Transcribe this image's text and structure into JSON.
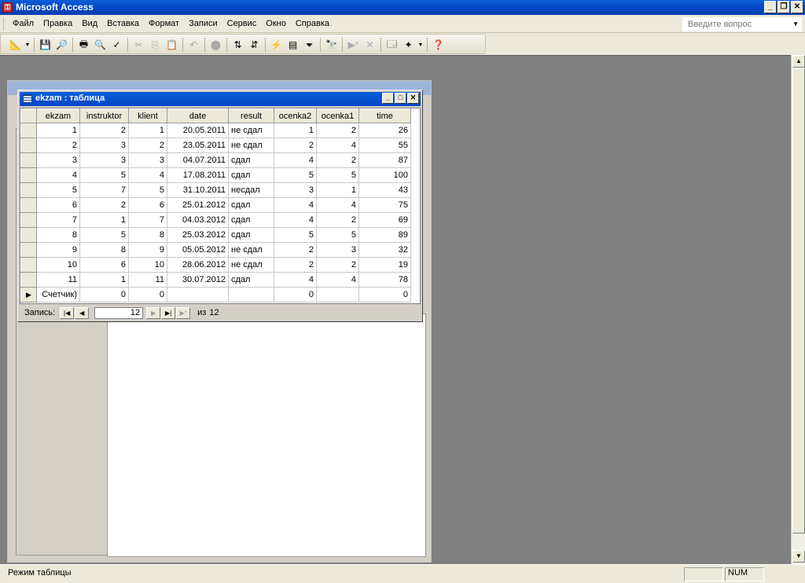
{
  "app": {
    "title": "Microsoft Access"
  },
  "menu": {
    "items": [
      "Файл",
      "Правка",
      "Вид",
      "Вставка",
      "Формат",
      "Записи",
      "Сервис",
      "Окно",
      "Справка"
    ],
    "help_placeholder": "Введите вопрос"
  },
  "table_window": {
    "title": "ekzam : таблица",
    "columns": [
      "ekzam",
      "instruktor",
      "klient",
      "date",
      "result",
      "ocenka2",
      "ocenka1",
      "time"
    ],
    "rows": [
      [
        "1",
        "2",
        "1",
        "20.05.2011",
        "не сдал",
        "1",
        "2",
        "26"
      ],
      [
        "2",
        "3",
        "2",
        "23.05.2011",
        "не сдал",
        "2",
        "4",
        "55"
      ],
      [
        "3",
        "3",
        "3",
        "04.07.2011",
        "сдал",
        "4",
        "2",
        "87"
      ],
      [
        "4",
        "5",
        "4",
        "17.08.2011",
        "сдал",
        "5",
        "5",
        "100"
      ],
      [
        "5",
        "7",
        "5",
        "31.10.2011",
        "несдал",
        "3",
        "1",
        "43"
      ],
      [
        "6",
        "2",
        "6",
        "25.01.2012",
        "сдал",
        "4",
        "4",
        "75"
      ],
      [
        "7",
        "1",
        "7",
        "04.03.2012",
        "сдал",
        "4",
        "2",
        "69"
      ],
      [
        "8",
        "5",
        "8",
        "25.03.2012",
        "сдал",
        "5",
        "5",
        "89"
      ],
      [
        "9",
        "8",
        "9",
        "05.05.2012",
        "не сдал",
        "2",
        "3",
        "32"
      ],
      [
        "10",
        "6",
        "10",
        "28.06.2012",
        "не сдал",
        "2",
        "2",
        "19"
      ],
      [
        "11",
        "1",
        "11",
        "30.07.2012",
        "сдал",
        "4",
        "4",
        "78"
      ]
    ],
    "new_row": [
      "Счетчик)",
      "0",
      "0",
      "",
      "",
      "0",
      "",
      "0"
    ],
    "nav": {
      "label": "Запись:",
      "current": "12",
      "of_label": "из",
      "total": "12"
    }
  },
  "status": {
    "text": "Режим таблицы",
    "num": "NUM"
  },
  "colors": {
    "titlebar": "#0346c4",
    "client_bg": "#808080",
    "chrome": "#ece9d8"
  }
}
